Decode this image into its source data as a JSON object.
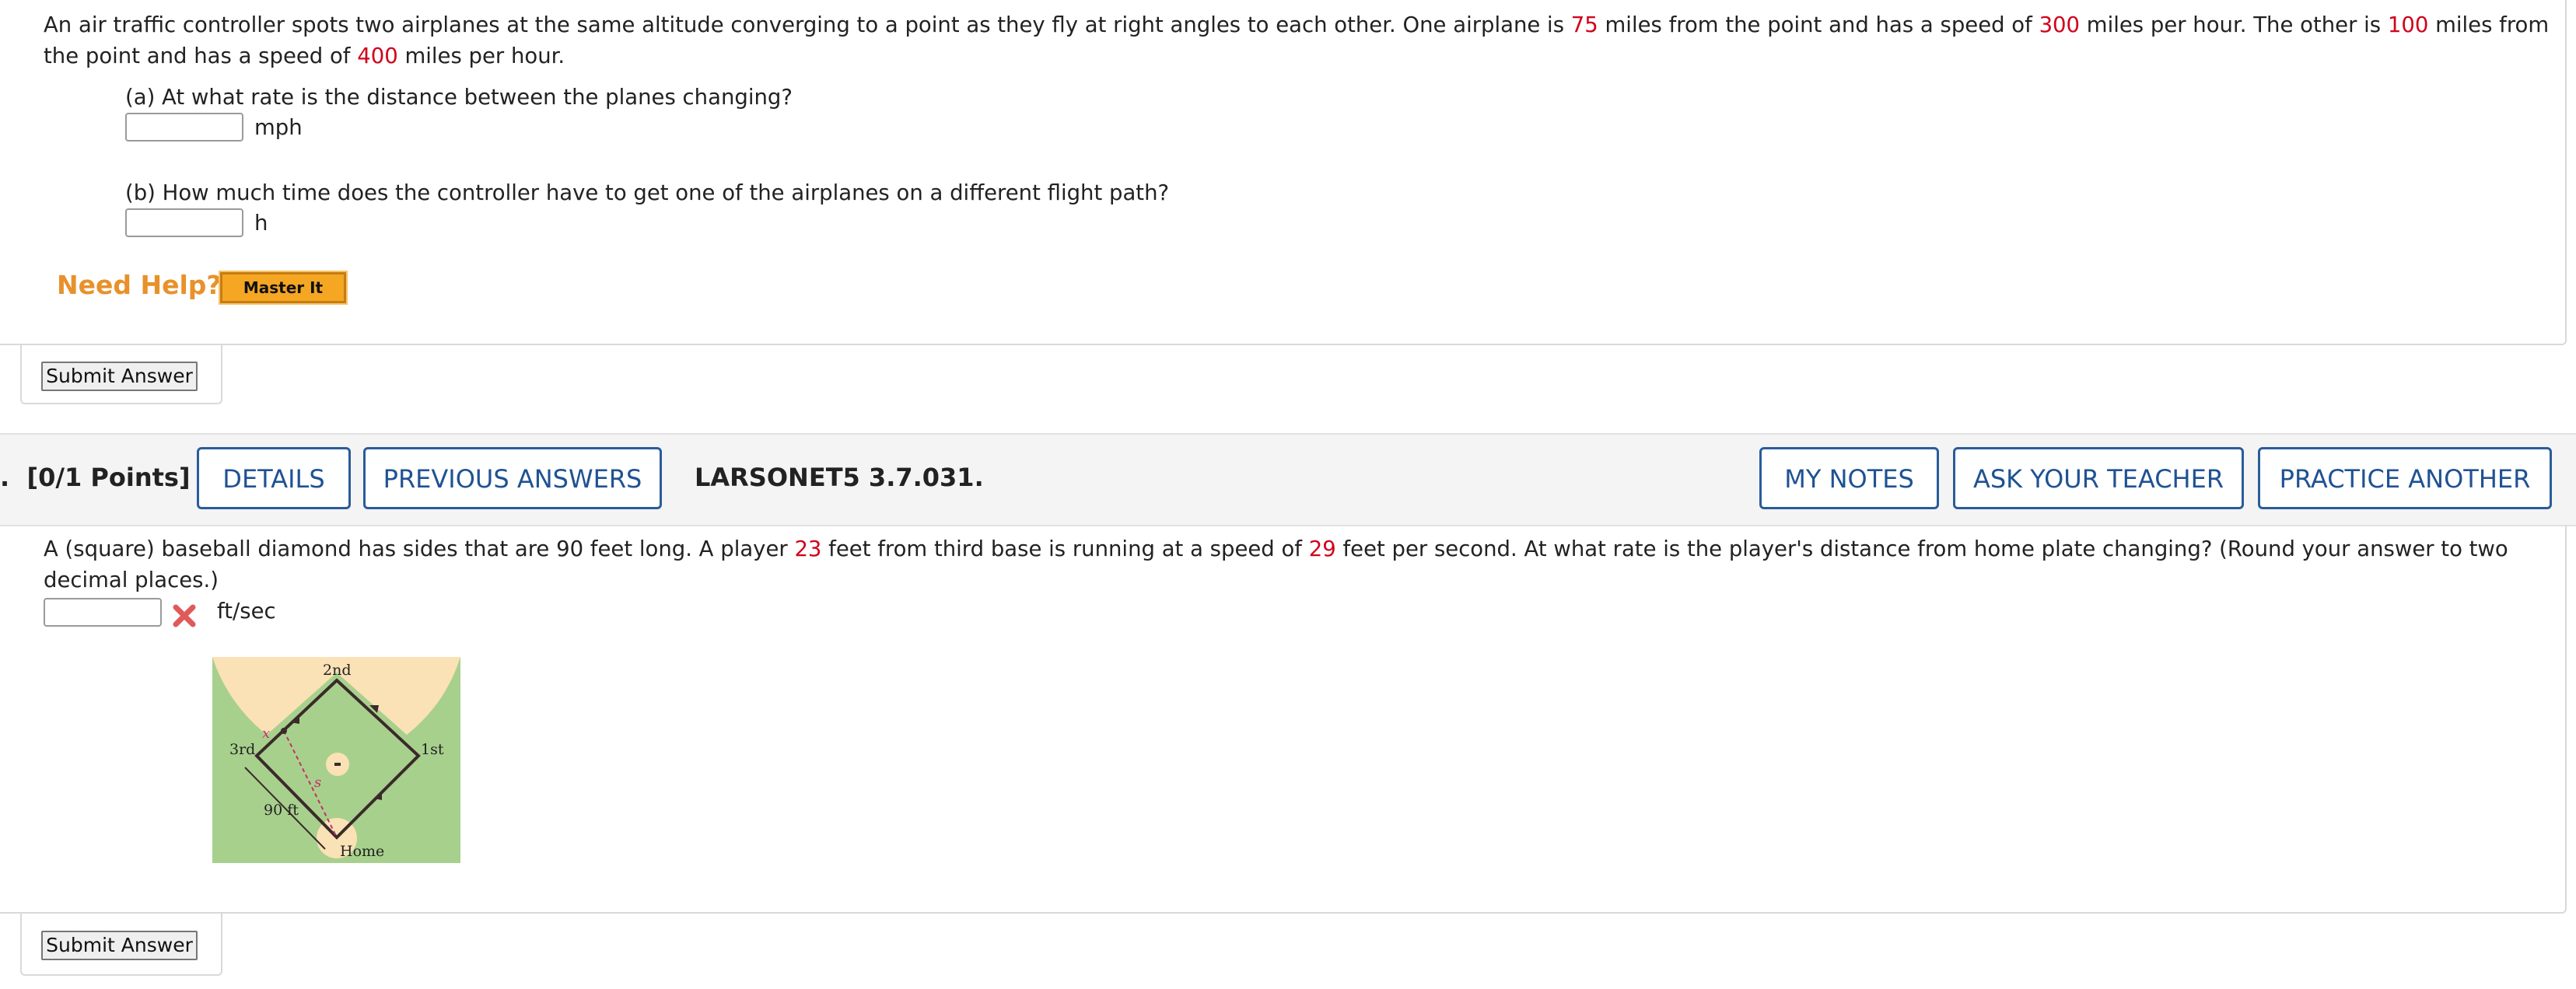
{
  "problem1": {
    "text_parts": [
      "An air traffic controller spots two airplanes at the same altitude converging to a point as they fly at right angles to each other. One airplane is ",
      "75",
      " miles from the point and has a speed of ",
      "300",
      " miles per hour. The other is ",
      "100",
      " miles from the point and has a speed of ",
      "400",
      " miles per hour."
    ],
    "part_a": {
      "question": "(a) At what rate is the distance between the planes changing?",
      "value": "",
      "unit": "mph"
    },
    "part_b": {
      "question": "(b) How much time does the controller have to get one of the airplanes on a different flight path?",
      "value": "",
      "unit": "h"
    },
    "need_help": "Need Help?",
    "master_it": "Master It",
    "submit": "Submit Answer"
  },
  "problem2": {
    "number_fragment": ".",
    "points": "[0/1 Points]",
    "buttons": {
      "details": "DETAILS",
      "previous_answers": "PREVIOUS ANSWERS",
      "my_notes": "MY NOTES",
      "ask_teacher": "ASK YOUR TEACHER",
      "practice_another": "PRACTICE ANOTHER"
    },
    "code": "LARSONET5 3.7.031.",
    "text_parts": [
      "A (square) baseball diamond has sides that are 90 feet long. A player ",
      "23",
      " feet from third base is running at a speed of ",
      "29",
      " feet per second. At what rate is the player's distance from home plate changing? (Round your answer to two decimal places.)"
    ],
    "answer": {
      "value": "",
      "unit": "ft/sec",
      "status": "incorrect"
    },
    "figure": {
      "labels": {
        "second": "2nd",
        "third": "3rd",
        "first": "1st",
        "home": "Home",
        "side": "90 ft",
        "x": "x",
        "s": "s"
      },
      "colors": {
        "grass": "#a8d08d",
        "dirt": "#fbe1b6",
        "line": "#3a2a2a",
        "dash": "#c0306a"
      }
    },
    "submit": "Submit Answer"
  }
}
